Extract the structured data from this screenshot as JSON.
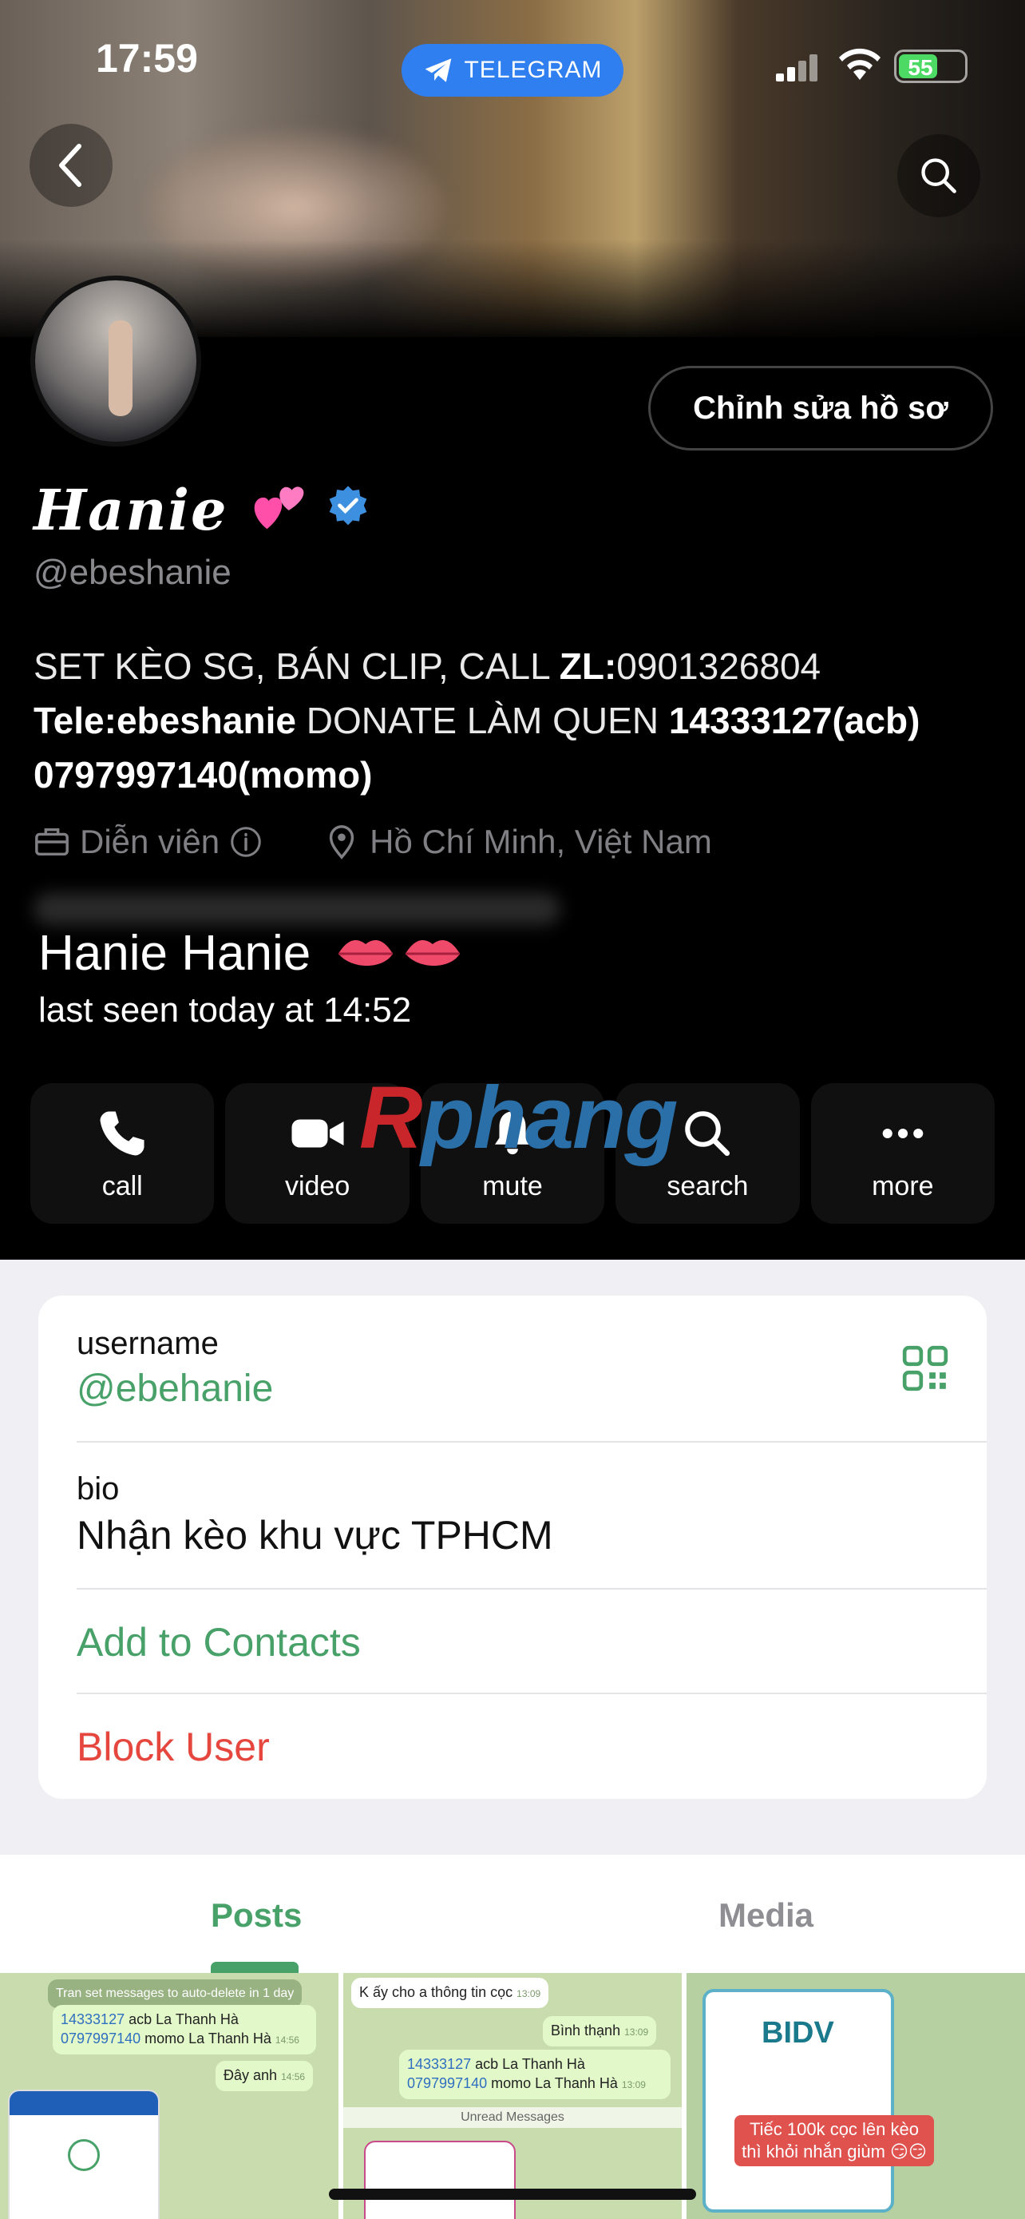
{
  "status_bar": {
    "time": "17:59",
    "pill_label": "TELEGRAM",
    "battery": "55"
  },
  "profile": {
    "edit_button": "Chỉnh sửa hồ sơ",
    "display_name": "Hanie",
    "handle": "@ebeshanie",
    "bio_line1_a": "SET KÈO SG, BÁN CLIP, CALL ",
    "bio_line1_b": "ZL:",
    "bio_line1_c": "0901326804",
    "bio_line2_a": "Tele:ebeshanie",
    "bio_line2_b": " DONATE LÀM QUEN ",
    "bio_line2_c": "14333127(acb)",
    "bio_line3": "0797997140(momo)",
    "job": "Diễn viên",
    "location": "Hồ Chí Minh, Việt Nam"
  },
  "user": {
    "name": "Hanie Hanie",
    "last_seen": "last seen today at 14:52"
  },
  "watermark": {
    "r": "R",
    "rest": "phang"
  },
  "actions": [
    {
      "label": "call",
      "icon": "phone-icon"
    },
    {
      "label": "video",
      "icon": "video-icon"
    },
    {
      "label": "mute",
      "icon": "bell-icon"
    },
    {
      "label": "search",
      "icon": "search-icon"
    },
    {
      "label": "more",
      "icon": "more-icon"
    }
  ],
  "info": {
    "username_label": "username",
    "username_value": "@ebehanie",
    "bio_label": "bio",
    "bio_value": "Nhận kèo khu vực TPHCM",
    "add_contacts": "Add to Contacts",
    "block_user": "Block User"
  },
  "tabs": {
    "posts": "Posts",
    "media": "Media"
  },
  "grid": {
    "cell1": {
      "system": "Tran set messages to auto-delete in 1 day",
      "line1a": "14333127",
      "line1b": " acb La Thanh Hà",
      "line2a": "0797997140",
      "line2b": " momo La Thanh Hà",
      "time1": "14:56",
      "reply": "Đây anh",
      "time2": "14:56"
    },
    "cell2": {
      "msg": "K ấy cho a thông tin cọc",
      "time1": "13:09",
      "reply": "Bình thạnh",
      "time2": "13:09",
      "line1a": "14333127",
      "line1b": " acb La Thanh Hà",
      "line2a": "0797997140",
      "line2b": " momo La Thanh Hà",
      "time3": "13:09",
      "unread": "Unread Messages"
    },
    "cell3": {
      "bank": "BIDV",
      "note": "Tiếc 100k cọc lên kèo thì khỏi nhắn giùm 😏😏"
    }
  },
  "colors": {
    "accent_green": "#47a168",
    "danger_red": "#e5473f",
    "telegram_blue": "#2f7ff0"
  }
}
